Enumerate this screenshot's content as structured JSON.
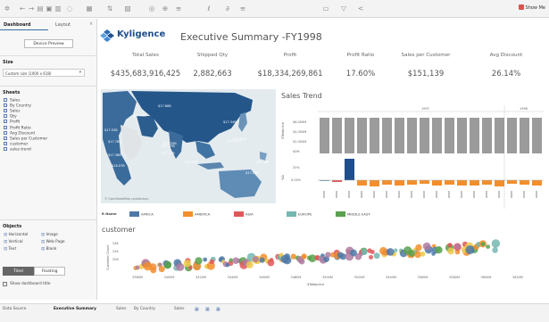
{
  "toolbar": {
    "icons": [
      "tableau-logo-icon",
      "undo-icon",
      "redo-icon",
      "save-icon",
      "new-data-source-icon",
      "add-sheet-icon",
      "pause-icon",
      "chart-type-icon",
      "swap-icon",
      "sort-ascending-icon",
      "sort-descending-icon",
      "group-icon",
      "label-icon",
      "fix-axes-icon",
      "highlight-icon",
      "fit-icon",
      "presentation-icon",
      "share-icon"
    ],
    "show_me": "Show Me"
  },
  "sidebar": {
    "tabs": [
      "Dashboard",
      "Layout"
    ],
    "device_preview": "Device Preview",
    "size_heading": "Size",
    "size_value": "Custom size (1000 x 618)",
    "sheets_heading": "Sheets",
    "sheets": [
      "Sales",
      "By Country",
      "Sales",
      "Qty",
      "Profit",
      "Profit Ratio",
      "Avg Discount",
      "Sales per Customer",
      "customer",
      "sales trend"
    ],
    "objects_heading": "Objects",
    "objects": [
      {
        "label": "Horizontal",
        "icon": "horizontal-icon"
      },
      {
        "label": "Image",
        "icon": "image-icon"
      },
      {
        "label": "Vertical",
        "icon": "vertical-icon"
      },
      {
        "label": "Web Page",
        "icon": "web-page-icon"
      },
      {
        "label": "Text",
        "icon": "text-icon"
      },
      {
        "label": "Blank",
        "icon": "blank-icon"
      }
    ],
    "tiled": "Tiled",
    "floating": "Floating",
    "show_title": "Show dashboard title"
  },
  "dashboard": {
    "logo_text": "Kyligence",
    "title": "Executive Summary -FY1998",
    "kpis": [
      {
        "label": "Total Sales",
        "value": "$435,683,916,425"
      },
      {
        "label": "Shipped Qty",
        "value": "2,882,663"
      },
      {
        "label": "Profit",
        "value": "$18,334,269,861"
      },
      {
        "label": "Profit Ratio",
        "value": "17.60%"
      },
      {
        "label": "Sales per Customer",
        "value": "$151,139"
      },
      {
        "label": "Avg Discount",
        "value": "26.14%"
      }
    ],
    "map_labels": [
      "$17.93B",
      "$17.86B",
      "$17.34B",
      "$17.61B",
      "$17.47B",
      "$17.53B",
      "$17.38B",
      "$18.07B",
      "$17.25B",
      "$17.27B",
      "$19.07B",
      "$17.35B",
      "$17.78B",
      "$17.04B",
      "$17.46B"
    ],
    "map_credit": "© OpenStreetMap contributors",
    "legend_title": "R Name",
    "legend": [
      {
        "name": "AFRICA",
        "color": "#4e79a7"
      },
      {
        "name": "AMERICA",
        "color": "#f28e2b"
      },
      {
        "name": "ASIA",
        "color": "#e15759"
      },
      {
        "name": "EUROPE",
        "color": "#76b7b2"
      },
      {
        "name": "MIDDLE EAST",
        "color": "#59a14f"
      }
    ],
    "sales_trend": {
      "title": "Sales Trend",
      "years": [
        "1997",
        "1998"
      ],
      "top_axis_label": "$Totalprice",
      "top_ticks": [
        "$6,000M",
        "$4,000M",
        "$2,000M",
        "$0M"
      ],
      "bottom_axis_label": "%Δ",
      "bottom_ticks": [
        "20%",
        "0.00%"
      ]
    },
    "customer": {
      "title": "customer",
      "y_axis_label": "Customer Count",
      "y_ticks": [
        "24K",
        "22K",
        "20K"
      ],
      "x_ticks": [
        "3380M",
        "3400M",
        "3420M",
        "3440M",
        "3460M",
        "3480M",
        "3500M",
        "3520M",
        "3540M",
        "3560M",
        "3580M",
        "3600M",
        "3620M"
      ],
      "x_axis_label": "$Totalprice"
    }
  },
  "bottom_tabs": [
    "Data Source",
    "Executive Summary",
    "Sales",
    "By Country",
    "Sales"
  ],
  "bottom_icons": [
    "new-sheet-icon",
    "new-dashboard-icon",
    "new-story-icon"
  ]
}
